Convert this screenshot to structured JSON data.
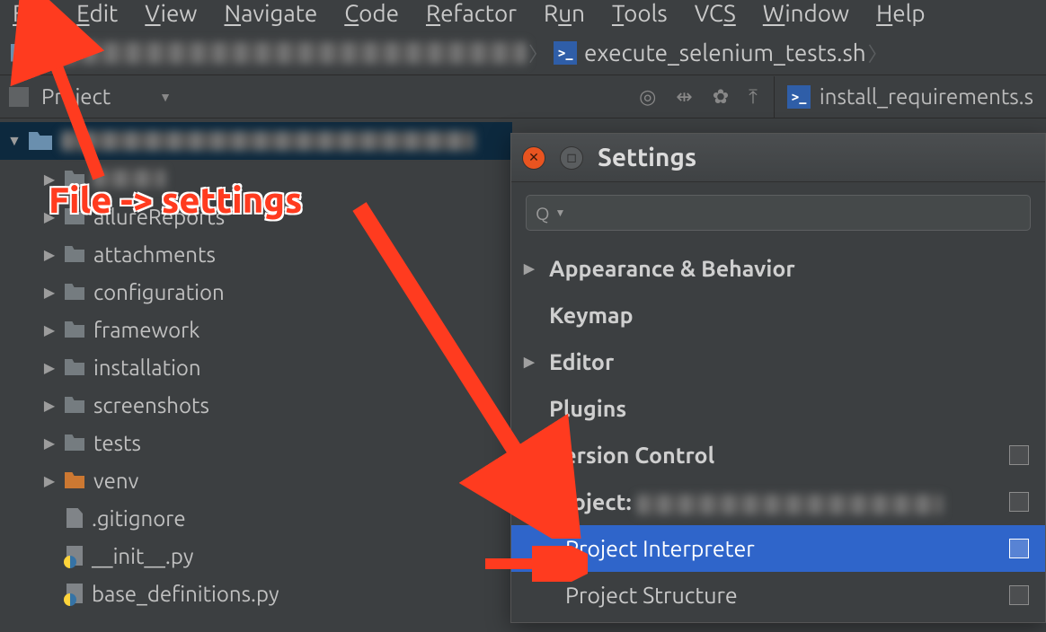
{
  "menu": {
    "file": "File",
    "edit": "Edit",
    "view": "View",
    "navigate": "Navigate",
    "code": "Code",
    "refactor": "Refactor",
    "run": "Run",
    "tools": "Tools",
    "vcs": "VCS",
    "window": "Window",
    "help": "Help"
  },
  "breadcrumb": {
    "project_name": "project_name_obscured",
    "file": "execute_selenium_tests.sh"
  },
  "toolwindow": {
    "label": "Project"
  },
  "editor": {
    "tab0": "install_requirements.s"
  },
  "tree": {
    "root": "project_root_obscured",
    "cache": "cache",
    "allure": "allureReports",
    "attachments": "attachments",
    "configuration": "configuration",
    "framework": "framework",
    "installation": "installation",
    "screenshots": "screenshots",
    "tests": "tests",
    "venv": "venv",
    "gitignore": ".gitignore",
    "init": "__init__.py",
    "basedefs": "base_definitions.py"
  },
  "dialog": {
    "title": "Settings",
    "search_placeholder": "",
    "items": {
      "appearance": "Appearance & Behavior",
      "keymap": "Keymap",
      "editor": "Editor",
      "plugins": "Plugins",
      "vcs": "Version Control",
      "project_prefix": "Project: ",
      "project_name": "obscured_project_name",
      "interpreter": "Project Interpreter",
      "structure": "Project Structure"
    }
  },
  "annotation": "File -> settings"
}
